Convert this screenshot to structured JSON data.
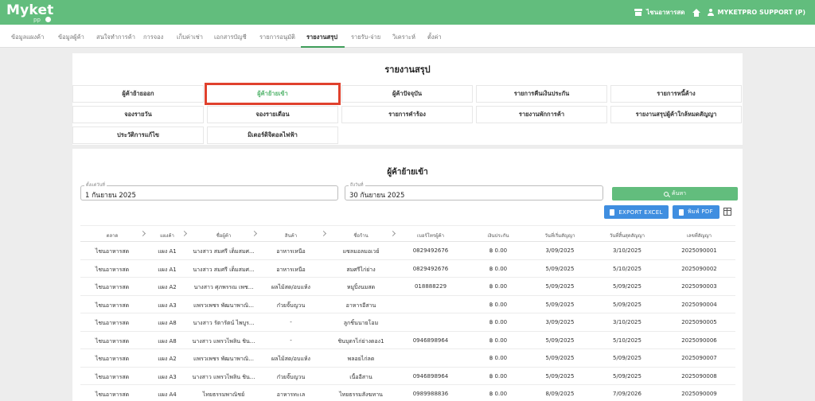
{
  "app": {
    "logo_text": "Myket",
    "logo_sub": "pp"
  },
  "header": {
    "store_name": "ไชนอาหารสด",
    "user_name": "MYKETPRO SUPPORT (P)"
  },
  "nav": {
    "items": [
      {
        "label": "ข้อมูลแผงค้า"
      },
      {
        "label": "ข้อมูลผู้ค้า"
      },
      {
        "label": "สนใจทำการค้า"
      },
      {
        "label": "การจอง"
      },
      {
        "label": "เก็บค่าเช่า"
      },
      {
        "label": "เอกสารบัญชี"
      },
      {
        "label": "รายการอนุมัติ"
      },
      {
        "label": "รายงานสรุป"
      },
      {
        "label": "รายรับ-จ่าย"
      },
      {
        "label": "วิเคราะห์"
      },
      {
        "label": "ตั้งค่า"
      }
    ],
    "active_index": 7
  },
  "report_panel": {
    "title": "รายงานสรุป",
    "buttons": [
      {
        "label": "ผู้ค้าย้ายออก"
      },
      {
        "label": "ผู้ค้าย้ายเข้า"
      },
      {
        "label": "ผู้ค้าปัจจุบัน"
      },
      {
        "label": "รายการคืนเงินประกัน"
      },
      {
        "label": "รายการหนี้ค้าง"
      },
      {
        "label": "จองรายวัน"
      },
      {
        "label": "จองรายเดือน"
      },
      {
        "label": "รายการคำร้อง"
      },
      {
        "label": "รายงานพักการค้า"
      },
      {
        "label": "รายงานสรุปผู้ค้าใกล้หมดสัญญา"
      },
      {
        "label": "ประวัติการแก้ไข"
      },
      {
        "label": "มิเตอร์ดิจิตอลไฟฟ้า"
      }
    ],
    "selected_index": 1
  },
  "filter": {
    "title": "ผู้ค้าย้ายเข้า",
    "start_label": "ตั้งแต่วันที่",
    "start_value": "1 กันยายน 2025",
    "end_label": "ถึงวันที่",
    "end_value": "30 กันยายน 2025",
    "search_label": "ค้นหา",
    "export_excel_label": "EXPORT EXCEL",
    "print_pdf_label": "พิมพ์ PDF"
  },
  "table": {
    "headers": [
      "ตลาด",
      "แผงค้า",
      "ชื่อผู้ค้า",
      "สินค้า",
      "ชื่อร้าน",
      "เบอร์โทรผู้ค้า",
      "เงินประกัน",
      "วันที่เริ่มสัญญา",
      "วันที่สิ้นสุดสัญญา",
      "เลขที่สัญญา"
    ],
    "rows": [
      [
        "ไชนอาหารสด",
        "แผง A1",
        "นางสาว สมศรี เต็มสมศ...",
        "อาหารเหนือ",
        "แซลมอลมอเวย์",
        "0829492676",
        "฿ 0.00",
        "3/09/2025",
        "3/10/2025",
        "2025090001"
      ],
      [
        "ไชนอาหารสด",
        "แผง A1",
        "นางสาว สมศรี เต็มสมศ...",
        "อาหารเหนือ",
        "สมศรีไก่ย่าง",
        "0829492676",
        "฿ 0.00",
        "5/09/2025",
        "5/10/2025",
        "2025090002"
      ],
      [
        "ไชนอาหารสด",
        "แผง A2",
        "นางสาว ศุภพรรณ เพช...",
        "ผลไม้สด/อบแห้ง",
        "หมูปิ้งนมสด",
        "018888229",
        "฿ 0.00",
        "5/09/2025",
        "5/09/2025",
        "2025090003"
      ],
      [
        "ไชนอาหารสด",
        "แผง A3",
        "แพรวเพชร พัฒนาพาณิ...",
        "ก๋วยจั๊บญวน",
        "อาหารอีสาน",
        "",
        "฿ 0.00",
        "5/09/2025",
        "5/09/2025",
        "2025090004"
      ],
      [
        "ไชนอาหารสด",
        "แผง A8",
        "นางสาว รัตารัตน์ ไพบูร...",
        "-",
        "ลูกชิ้นนายโอม",
        "",
        "฿ 0.00",
        "3/09/2025",
        "3/10/2025",
        "2025090005"
      ],
      [
        "ไชนอาหารสด",
        "แผง A8",
        "นางสาว แพรวไพลิน ชิน...",
        "-",
        "ชินบุตรไก่ย่างตอง1",
        "0946898964",
        "฿ 0.00",
        "5/09/2025",
        "5/10/2025",
        "2025090006"
      ],
      [
        "ไชนอาหารสด",
        "แผง A2",
        "แพรวเพชร พัฒนาพาณิ...",
        "ผลไม้สด/อบแห้ง",
        "พลอยไก่ลด",
        "",
        "฿ 0.00",
        "5/09/2025",
        "5/09/2025",
        "2025090007"
      ],
      [
        "ไชนอาหารสด",
        "แผง A3",
        "นางสาว แพรวไพลิน ชิน...",
        "ก๋วยจั๊บญวน",
        "เนื้ออีสาน",
        "0946898964",
        "฿ 0.00",
        "5/09/2025",
        "5/09/2025",
        "2025090008"
      ],
      [
        "ไชนอาหารสด",
        "แผง A4",
        "ไทยธรรมพาณิชย์",
        "อาหารทะเล",
        "ไทยธรรมสังฆทาน",
        "0989988836",
        "฿ 0.00",
        "8/09/2025",
        "7/09/2026",
        "2025090009"
      ]
    ]
  }
}
